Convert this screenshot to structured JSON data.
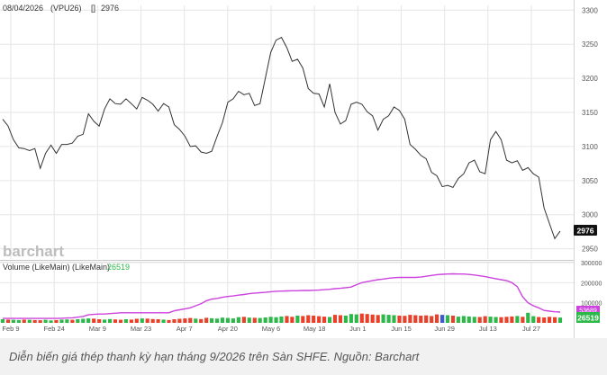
{
  "header": {
    "date": "08/04/2026",
    "symbol": "(VPU26)",
    "brackets": "[]",
    "last": "2976"
  },
  "watermark": "barchart",
  "caption": "Diễn biến giá thép thanh kỳ hạn tháng 9/2026 trên Sàn SHFE. Nguồn: Barchart",
  "colors": {
    "price_line": "#333333",
    "volume_up": "#2db84a",
    "volume_down": "#e8402a",
    "volume_other": "#3b5bd6",
    "open_interest": "#cc44dd",
    "grid": "#e6e6e6",
    "axis_text": "#555555",
    "last_tag_bg": "#111111",
    "volume_tag_bg": "#2db84a"
  },
  "chart_data": [
    {
      "type": "line",
      "name": "price",
      "x_tick_labels": [
        "Feb 9",
        "Feb 24",
        "Mar 9",
        "Mar 23",
        "Apr 7",
        "Apr 20",
        "May 6",
        "May 18",
        "Jun 1",
        "Jun 15",
        "Jun 29",
        "Jul 13",
        "Jul 27"
      ],
      "y_ticks": [
        2950,
        3000,
        3050,
        3100,
        3150,
        3200,
        3250,
        3300
      ],
      "ylim": [
        2935,
        3307
      ],
      "last_value": "2976",
      "values": [
        3140,
        3130,
        3110,
        3098,
        3097,
        3094,
        3097,
        3068,
        3090,
        3102,
        3090,
        3103,
        3103,
        3105,
        3115,
        3118,
        3148,
        3137,
        3130,
        3155,
        3170,
        3163,
        3162,
        3170,
        3163,
        3155,
        3172,
        3168,
        3162,
        3152,
        3163,
        3158,
        3132,
        3125,
        3115,
        3100,
        3101,
        3092,
        3090,
        3093,
        3115,
        3135,
        3165,
        3170,
        3181,
        3176,
        3178,
        3160,
        3163,
        3200,
        3238,
        3256,
        3260,
        3245,
        3225,
        3228,
        3215,
        3185,
        3178,
        3177,
        3158,
        3192,
        3150,
        3133,
        3138,
        3162,
        3165,
        3162,
        3151,
        3145,
        3124,
        3140,
        3145,
        3158,
        3153,
        3140,
        3103,
        3096,
        3087,
        3082,
        3062,
        3057,
        3041,
        3043,
        3040,
        3053,
        3060,
        3076,
        3080,
        3063,
        3060,
        3110,
        3122,
        3110,
        3080,
        3076,
        3079,
        3065,
        3069,
        3060,
        3055,
        3010,
        2987,
        2965,
        2976
      ]
    },
    {
      "type": "bar",
      "name": "Volume (LikeMain)",
      "legend_title": "Volume (LikeMain) (LikeMain)",
      "last_value": "26519",
      "y_ticks": [
        100000,
        200000,
        300000
      ],
      "tick_labels": [
        "100000",
        "200000",
        "300000"
      ],
      "ylim": [
        0,
        300000
      ],
      "values": [
        18000,
        16000,
        15000,
        14000,
        16000,
        15000,
        14000,
        13000,
        15000,
        12000,
        14000,
        16000,
        17000,
        15000,
        18000,
        20000,
        22000,
        21000,
        18000,
        16000,
        19000,
        17000,
        15000,
        18000,
        16000,
        20000,
        22000,
        21000,
        19000,
        18000,
        16000,
        14000,
        18000,
        20000,
        22000,
        24000,
        21000,
        19000,
        25000,
        23000,
        21000,
        26000,
        24000,
        22000,
        28000,
        30000,
        26000,
        25000,
        24000,
        27000,
        30000,
        28000,
        32000,
        34000,
        30000,
        36000,
        34000,
        38000,
        36000,
        33000,
        31000,
        29000,
        40000,
        38000,
        36000,
        44000,
        42000,
        46000,
        44000,
        41000,
        39000,
        42000,
        40000,
        38000,
        36000,
        35000,
        40000,
        38000,
        36000,
        37000,
        34000,
        42000,
        40000,
        38000,
        36000,
        31000,
        34000,
        32000,
        30000,
        29000,
        33000,
        31000,
        29000,
        28000,
        30000,
        32000,
        34000,
        30000,
        50000,
        33000,
        29000,
        27000,
        30000,
        28000,
        26519
      ],
      "colors": [
        "#2db84a",
        "#e8402a",
        "#2db84a",
        "#2db84a",
        "#e8402a",
        "#2db84a",
        "#e8402a",
        "#e8402a",
        "#2db84a",
        "#2db84a",
        "#e8402a",
        "#2db84a",
        "#2db84a",
        "#e8402a",
        "#2db84a",
        "#2db84a",
        "#2db84a",
        "#e8402a",
        "#e8402a",
        "#2db84a",
        "#2db84a",
        "#e8402a",
        "#e8402a",
        "#2db84a",
        "#e8402a",
        "#e8402a",
        "#2db84a",
        "#e8402a",
        "#e8402a",
        "#e8402a",
        "#2db84a",
        "#e8402a",
        "#e8402a",
        "#e8402a",
        "#e8402a",
        "#e8402a",
        "#2db84a",
        "#e8402a",
        "#e8402a",
        "#2db84a",
        "#2db84a",
        "#2db84a",
        "#2db84a",
        "#2db84a",
        "#2db84a",
        "#e8402a",
        "#2db84a",
        "#e8402a",
        "#2db84a",
        "#2db84a",
        "#2db84a",
        "#2db84a",
        "#2db84a",
        "#e8402a",
        "#e8402a",
        "#2db84a",
        "#e8402a",
        "#e8402a",
        "#e8402a",
        "#e8402a",
        "#e8402a",
        "#2db84a",
        "#e8402a",
        "#e8402a",
        "#2db84a",
        "#2db84a",
        "#2db84a",
        "#e8402a",
        "#e8402a",
        "#e8402a",
        "#e8402a",
        "#2db84a",
        "#2db84a",
        "#2db84a",
        "#e8402a",
        "#e8402a",
        "#e8402a",
        "#e8402a",
        "#e8402a",
        "#e8402a",
        "#e8402a",
        "#e8402a",
        "#3b5bd6",
        "#2db84a",
        "#e8402a",
        "#2db84a",
        "#2db84a",
        "#2db84a",
        "#2db84a",
        "#e8402a",
        "#e8402a",
        "#2db84a",
        "#2db84a",
        "#e8402a",
        "#e8402a",
        "#e8402a",
        "#2db84a",
        "#e8402a",
        "#2db84a",
        "#2db84a",
        "#e8402a",
        "#e8402a",
        "#e8402a",
        "#e8402a",
        "#2db84a"
      ]
    },
    {
      "type": "line",
      "name": "open interest",
      "last_value": "53689",
      "values": [
        22000,
        22000,
        22000,
        22000,
        22000,
        22000,
        22000,
        22000,
        22000,
        22000,
        22000,
        23000,
        24000,
        25000,
        28000,
        32000,
        40000,
        42000,
        44000,
        44000,
        46000,
        48000,
        50000,
        50000,
        50000,
        50000,
        50000,
        50000,
        50000,
        50000,
        50000,
        50000,
        60000,
        65000,
        70000,
        75000,
        85000,
        95000,
        110000,
        118000,
        122000,
        127000,
        131000,
        134000,
        138000,
        141000,
        145000,
        148000,
        150000,
        152000,
        155000,
        157000,
        158000,
        159000,
        160000,
        160000,
        161000,
        161000,
        162000,
        163000,
        165000,
        167000,
        170000,
        172000,
        175000,
        178000,
        190000,
        200000,
        205000,
        210000,
        215000,
        218000,
        222000,
        225000,
        226000,
        226000,
        226000,
        226000,
        228000,
        232000,
        236000,
        240000,
        242000,
        243000,
        244000,
        243000,
        243000,
        241000,
        238000,
        234000,
        230000,
        225000,
        220000,
        215000,
        210000,
        200000,
        180000,
        130000,
        100000,
        85000,
        75000,
        62000,
        58000,
        55000,
        53689
      ]
    }
  ]
}
